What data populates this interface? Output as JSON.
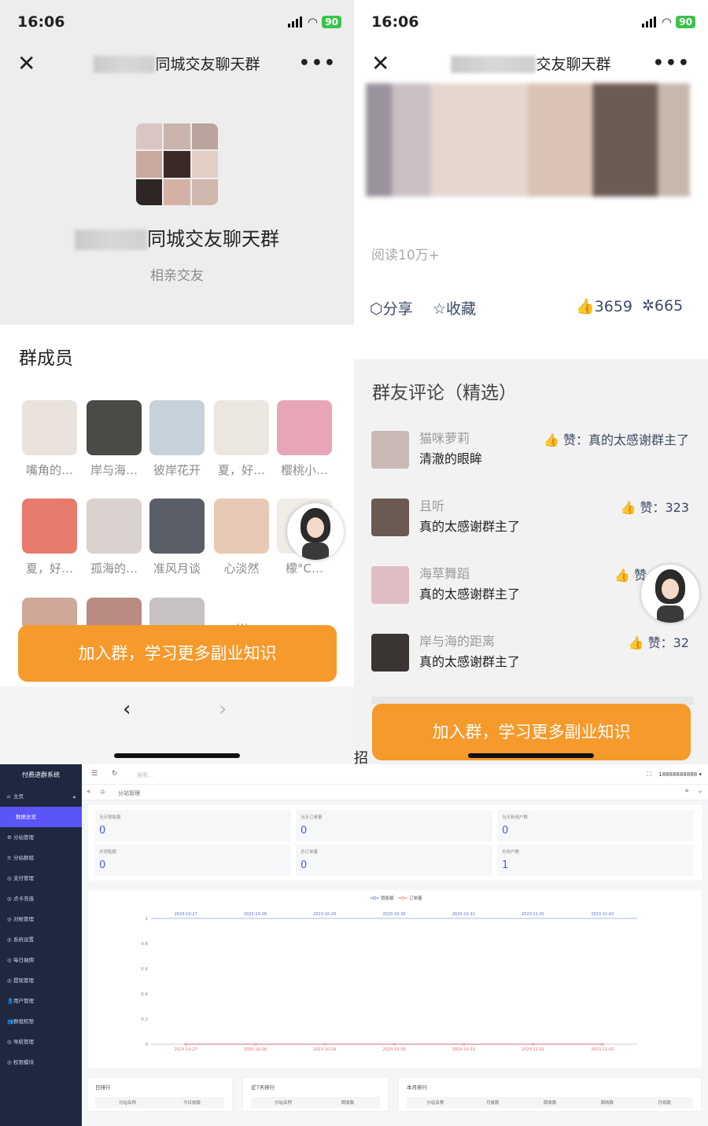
{
  "screen1": {
    "time": "16:06",
    "battery": "90",
    "nav_title_suffix": "同城交友聊天群",
    "group_name_suffix": "同城交友聊天群",
    "group_subtitle": "相亲交友",
    "members_title": "群成员",
    "members": [
      {
        "name": "嘴角的…"
      },
      {
        "name": "岸与海…"
      },
      {
        "name": "彼岸花开"
      },
      {
        "name": "夏，好…"
      },
      {
        "name": "樱桃小…"
      },
      {
        "name": "夏，好…"
      },
      {
        "name": "孤海的…"
      },
      {
        "name": "准风月谈"
      },
      {
        "name": "心淡然"
      },
      {
        "name": "檬°C…"
      }
    ],
    "more": "…",
    "join_button": "加入群，学习更多副业知识"
  },
  "screen2": {
    "time": "16:06",
    "battery": "90",
    "nav_title_suffix": "交友聊天群",
    "reads": "阅读10万+",
    "share": "分享",
    "favorite": "收藏",
    "likes": "3659",
    "shares_count": "665",
    "comments_title": "群友评论（精选）",
    "comments": [
      {
        "user": "猫咪萝莉",
        "text": "清澈的眼眸",
        "like": "赞：真的太感谢群主了"
      },
      {
        "user": "且听",
        "text": "真的太感谢群主了",
        "like": "赞：323"
      },
      {
        "user": "海草舞蹈",
        "text": "真的太感谢群主了",
        "like": "赞"
      },
      {
        "user": "岸与海的距离",
        "text": "真的太感谢群主了",
        "like": "赞：32"
      }
    ],
    "join_button": "加入群，学习更多副业知识",
    "bottom_tag": "招"
  },
  "admin": {
    "brand": "付费进群系统",
    "menu_home": "主页",
    "menu": [
      "数据总览",
      "分站管理",
      "分站群组",
      "支付管理",
      "点卡充值",
      "对帐管理",
      "系统设置",
      "每日抽佣",
      "提现管理",
      "用户管理",
      "群组权限",
      "导航管理",
      "权限模块"
    ],
    "search_placeholder": "搜索...",
    "account": "18888888888",
    "tab": "分站管理",
    "kpis": [
      {
        "label": "当天销售额",
        "value": "0"
      },
      {
        "label": "当天订单量",
        "value": "0"
      },
      {
        "label": "当天新用户数",
        "value": "0"
      },
      {
        "label": "总销售额",
        "value": "0"
      },
      {
        "label": "总订单量",
        "value": "0"
      },
      {
        "label": "总用户数",
        "value": "1"
      }
    ],
    "ranks": [
      {
        "title": "日排行",
        "cols": [
          "分站名称",
          "今日收款"
        ]
      },
      {
        "title": "近7天排行",
        "cols": [
          "分站名称",
          "周收款"
        ]
      },
      {
        "title": "本月排行",
        "cols": [
          "分站名称",
          "月收款",
          "周收款",
          "周收款",
          "月收款"
        ]
      }
    ]
  },
  "chart_data": {
    "type": "line",
    "categories": [
      "2023-10-27",
      "2023-10-28",
      "2023-10-29",
      "2023-10-30",
      "2023-10-31",
      "2023-11-01",
      "2023-11-02"
    ],
    "series": [
      {
        "name": "销售额",
        "values": [
          0,
          0,
          0,
          0,
          0,
          0,
          0
        ],
        "color": "#5470c6"
      },
      {
        "name": "订单量",
        "values": [
          0,
          0,
          0,
          0,
          0,
          0,
          0
        ],
        "color": "#ee6666"
      }
    ],
    "yticks": [
      "0",
      "0.2",
      "0.4",
      "0.6",
      "0.8",
      "1"
    ],
    "ylim": [
      0,
      1
    ],
    "legend": "top-center",
    "grid": false
  }
}
